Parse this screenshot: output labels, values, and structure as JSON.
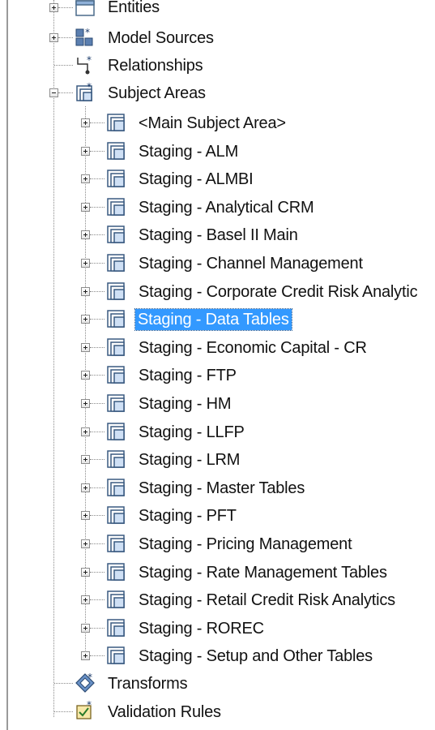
{
  "tree": {
    "top_items": [
      {
        "label": "Entities",
        "icon": "entities-icon",
        "expander": "plus"
      },
      {
        "label": "Model Sources",
        "icon": "model-sources-icon",
        "expander": "plus"
      },
      {
        "label": "Relationships",
        "icon": "relationships-icon",
        "expander": "none"
      },
      {
        "label": "Subject Areas",
        "icon": "subject-areas-icon",
        "expander": "minus"
      }
    ],
    "subject_areas": [
      {
        "label": "<Main Subject Area>"
      },
      {
        "label": "Staging - ALM"
      },
      {
        "label": "Staging - ALMBI"
      },
      {
        "label": "Staging - Analytical CRM"
      },
      {
        "label": "Staging - Basel II Main"
      },
      {
        "label": "Staging - Channel Management"
      },
      {
        "label": "Staging - Corporate Credit Risk Analytic"
      },
      {
        "label": "Staging - Data Tables",
        "selected": true
      },
      {
        "label": "Staging - Economic Capital - CR"
      },
      {
        "label": "Staging - FTP"
      },
      {
        "label": "Staging - HM"
      },
      {
        "label": "Staging - LLFP"
      },
      {
        "label": "Staging - LRM"
      },
      {
        "label": "Staging - Master Tables"
      },
      {
        "label": "Staging - PFT"
      },
      {
        "label": "Staging - Pricing Management"
      },
      {
        "label": "Staging - Rate Management Tables"
      },
      {
        "label": "Staging - Retail Credit Risk Analytics"
      },
      {
        "label": "Staging - ROREC"
      },
      {
        "label": "Staging - Setup and Other Tables"
      }
    ],
    "bottom_items": [
      {
        "label": "Transforms",
        "icon": "transforms-icon"
      },
      {
        "label": "Validation Rules",
        "icon": "validation-rules-icon"
      }
    ],
    "selection_color": "#3399ff"
  }
}
